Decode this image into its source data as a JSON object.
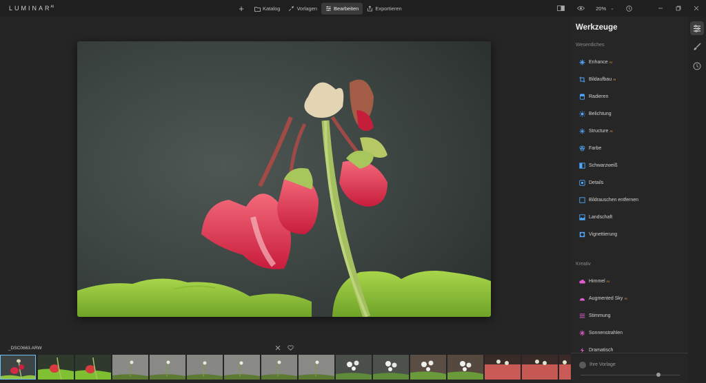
{
  "app": {
    "logo": "LUMINAR",
    "logo_sup": "AI"
  },
  "topnav": {
    "add_label": "+",
    "items": [
      {
        "label": "Katalog",
        "icon": "folder-icon"
      },
      {
        "label": "Vorlagen",
        "icon": "presets-icon"
      },
      {
        "label": "Bearbeiten",
        "icon": "edit-icon",
        "active": true
      },
      {
        "label": "Exportieren",
        "icon": "export-icon"
      }
    ]
  },
  "topright": {
    "zoom": "20%"
  },
  "panel": {
    "title": "Werkzeuge",
    "sections": [
      {
        "label": "Wesentliches",
        "tools": [
          {
            "label": "Enhance",
            "ai": "AI",
            "icon": "enhance-icon",
            "color": "#4fa8ff"
          },
          {
            "label": "Bildaufbau",
            "ai": "AI",
            "icon": "crop-icon",
            "color": "#4fa8ff"
          },
          {
            "label": "Radieren",
            "ai": "",
            "icon": "eraser-icon",
            "color": "#4fa8ff"
          },
          {
            "label": "Belichtung",
            "ai": "",
            "icon": "sun-icon",
            "color": "#4fa8ff"
          },
          {
            "label": "Structure",
            "ai": "AI",
            "icon": "structure-icon",
            "color": "#4fa8ff"
          },
          {
            "label": "Farbe",
            "ai": "",
            "icon": "color-icon",
            "color": "#4fa8ff"
          },
          {
            "label": "Schwarzweiß",
            "ai": "",
            "icon": "bw-icon",
            "color": "#4fa8ff"
          },
          {
            "label": "Details",
            "ai": "",
            "icon": "details-icon",
            "color": "#4fa8ff"
          },
          {
            "label": "Bildrauschen entfernen",
            "ai": "",
            "icon": "denoise-icon",
            "color": "#4fa8ff"
          },
          {
            "label": "Landschaft",
            "ai": "",
            "icon": "landscape-icon",
            "color": "#4fa8ff"
          },
          {
            "label": "Vignettierung",
            "ai": "",
            "icon": "vignette-icon",
            "color": "#4fa8ff"
          }
        ]
      },
      {
        "label": "Kreativ",
        "tools": [
          {
            "label": "Himmel",
            "ai": "AI",
            "icon": "cloud-icon",
            "color": "#e05bd0"
          },
          {
            "label": "Augmented Sky",
            "ai": "AI",
            "icon": "augmented-sky-icon",
            "color": "#e05bd0"
          },
          {
            "label": "Stimmung",
            "ai": "",
            "icon": "mood-icon",
            "color": "#e05bd0"
          },
          {
            "label": "Sonnenstrahlen",
            "ai": "",
            "icon": "sunrays-icon",
            "color": "#e05bd0"
          },
          {
            "label": "Dramatisch",
            "ai": "",
            "icon": "dramatic-icon",
            "color": "#e05bd0"
          }
        ]
      }
    ],
    "preset": {
      "label": "Ihre Vorlage"
    }
  },
  "filmstrip": {
    "filename": "_DSC0663.ARW"
  },
  "colors": {
    "accent": "#6ec3ff",
    "essential": "#4fa8ff",
    "creative": "#e05bd0"
  }
}
